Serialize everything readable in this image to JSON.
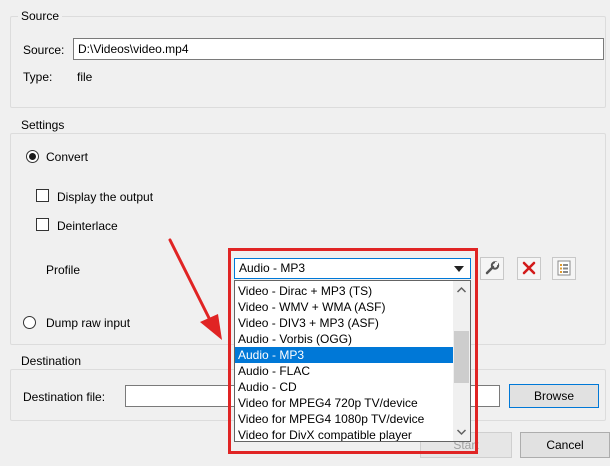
{
  "source": {
    "group_title": "Source",
    "source_label": "Source:",
    "source_value": "D:\\Videos\\video.mp4",
    "type_label": "Type:",
    "type_value": "file"
  },
  "settings": {
    "group_title": "Settings",
    "convert_label": "Convert",
    "display_output_label": "Display the output",
    "deinterlace_label": "Deinterlace",
    "profile_label": "Profile",
    "profile_selected": "Audio - MP3",
    "profile_options": [
      "Video - Dirac + MP3 (TS)",
      "Video - WMV + WMA (ASF)",
      "Video - DIV3 + MP3 (ASF)",
      "Audio - Vorbis (OGG)",
      "Audio - MP3",
      "Audio - FLAC",
      "Audio - CD",
      "Video for MPEG4 720p TV/device",
      "Video for MPEG4 1080p TV/device",
      "Video for DivX compatible player"
    ],
    "selected_index": 4,
    "dump_raw_label": "Dump raw input"
  },
  "destination": {
    "group_title": "Destination",
    "file_label": "Destination file:",
    "file_value": "",
    "browse_label": "Browse"
  },
  "footer": {
    "start_label": "Start",
    "cancel_label": "Cancel"
  },
  "colors": {
    "highlight": "#e02424",
    "selection": "#0078d7"
  }
}
